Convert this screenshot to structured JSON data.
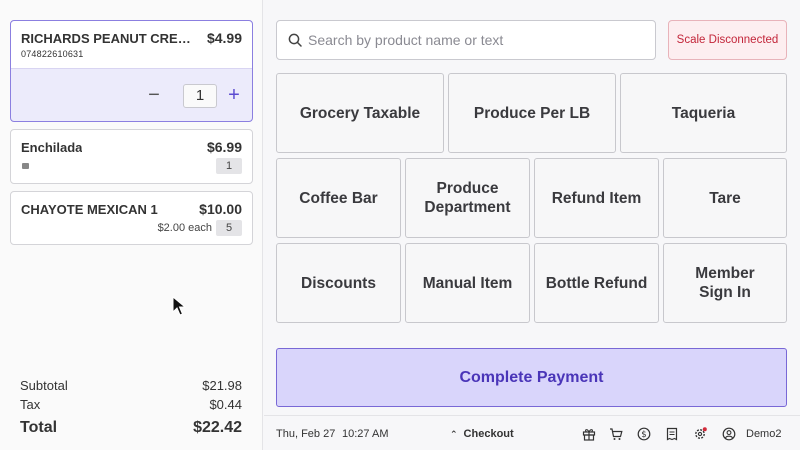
{
  "cart": {
    "items": [
      {
        "name": "RICHARDS PEANUT CREA...",
        "price": "$4.99",
        "barcode": "074822610631",
        "quantity": "1"
      },
      {
        "name": "Enchilada",
        "price": "$6.99",
        "quantity": "1"
      },
      {
        "name": "CHAYOTE MEXICAN 1",
        "price": "$10.00",
        "each": "$2.00 each",
        "quantity": "5"
      }
    ],
    "qty_minus": "−",
    "qty_plus": "+"
  },
  "totals": {
    "subtotal_label": "Subtotal",
    "subtotal": "$21.98",
    "tax_label": "Tax",
    "tax": "$0.44",
    "total_label": "Total",
    "total": "$22.42"
  },
  "search": {
    "placeholder": "Search by product name or text",
    "value": ""
  },
  "scale_status": "Scale Disconnected",
  "tiles": [
    "Grocery Taxable",
    "Produce Per LB",
    "Taqueria",
    "Coffee Bar",
    "Produce Department",
    "Refund Item",
    "Tare",
    "Discounts",
    "Manual Item",
    "Bottle Refund",
    "Member Sign In"
  ],
  "pay_label": "Complete Payment",
  "status": {
    "date": "Thu, Feb 27",
    "time": "10:27 AM",
    "checkout": "Checkout",
    "user": "Demo2"
  },
  "icons": [
    "gift-icon",
    "cart-icon",
    "dollar-icon",
    "receipt-icon",
    "settings-icon",
    "user-icon"
  ],
  "colors": {
    "accent": "#5b4bd0",
    "pay_bg": "#d9d5fb",
    "alert": "#c3263a"
  }
}
